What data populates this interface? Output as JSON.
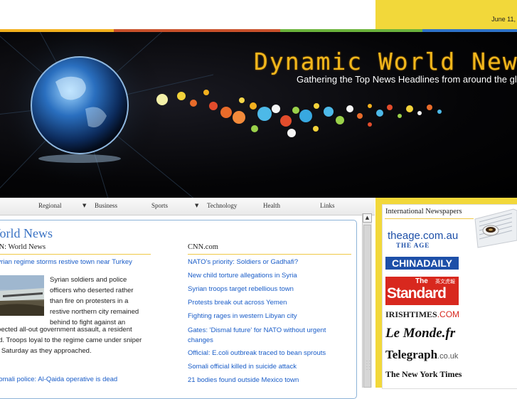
{
  "header": {
    "date": "June 11,",
    "stripe_colors": [
      "#f2b01e",
      "#c9512b",
      "#6bb33c",
      "#2f73c7"
    ]
  },
  "banner": {
    "title": "Dynamic World News",
    "subtitle": "Gathering the Top News Headlines from around the globe"
  },
  "nav": {
    "items": [
      {
        "label": "Regional",
        "dropdown": false
      },
      {
        "label": "Business",
        "dropdown": true
      },
      {
        "label": "Sports",
        "dropdown": false
      },
      {
        "label": "Technology",
        "dropdown": true
      },
      {
        "label": "Health",
        "dropdown": false
      },
      {
        "label": "Links",
        "dropdown": false
      }
    ]
  },
  "main": {
    "heading": "World News",
    "left_column": {
      "title": "CNN: World News",
      "lead_headline": "Syrian regime storms restive town near Turkey",
      "lead_text_wrapped": [
        "Syrian soldiers and police",
        "officers who deserted rather",
        "than fire on protesters in a",
        "restive northern city remained",
        "behind to fight against an"
      ],
      "lead_text_full": [
        "expected all-out government assault, a resident",
        "said. Troops loyal to the regime came under sniper",
        "fire Saturday as they approached."
      ],
      "second_headline": "Somali police: Al-Qaida operative is dead"
    },
    "right_column": {
      "title": "CNN.com",
      "headlines": [
        "NATO's priority: Soldiers or Gadhafi?",
        "New child torture allegations in Syria",
        "Syrian troops target rebellious town",
        "Protests break out across Yemen",
        "Fighting rages in western Libyan city",
        "Gates: 'Dismal future' for NATO without urgent changes",
        "Official: E.coli outbreak traced to bean sprouts",
        "Somali official killed in suicide attack",
        "21 bodies found outside Mexico town"
      ]
    }
  },
  "sidebar": {
    "title": "International Newspapers",
    "papers": {
      "theage_main": "theage.com.au",
      "theage_sub": "THE AGE",
      "chinadaily": "CHINADAILY",
      "standard_the": "The",
      "standard_main": "Standard",
      "standard_cjk": "英文虎報",
      "irish_main": "IRISHTIMES",
      "irish_suffix": ".COM",
      "lemonde": "Le Monde.fr",
      "telegraph_main": "Telegraph",
      "telegraph_suffix": ".co.uk",
      "nyt": "The New York Times"
    }
  }
}
